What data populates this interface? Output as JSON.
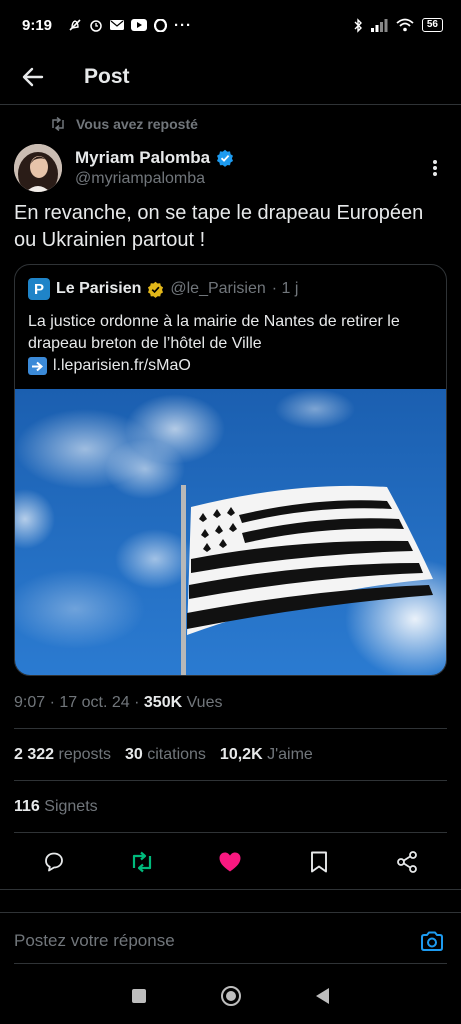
{
  "status_bar": {
    "time": "9:19",
    "battery": "56",
    "left_icons": [
      "do-not-disturb-icon",
      "alarm-icon",
      "mail-icon",
      "youtube-icon",
      "opera-icon",
      "more-icon"
    ],
    "right_icons": [
      "bluetooth-icon",
      "signal-icon",
      "wifi-icon",
      "battery-icon"
    ]
  },
  "header": {
    "title": "Post"
  },
  "repost": {
    "label": "Vous avez reposté"
  },
  "author": {
    "name": "Myriam Palomba",
    "handle": "@myriampalomba",
    "verified_color": "#1d9bf0"
  },
  "post": {
    "text": "En revanche, on se tape le drapeau Européen ou Ukrainien partout !"
  },
  "quote": {
    "logo_letter": "P",
    "name": "Le Parisien",
    "handle": "@le_Parisien",
    "time": "· 1 j",
    "text": "La justice ordonne à la mairie de Nantes de retirer le drapeau breton de l’hôtel de Ville",
    "link": "l.leparisien.fr/sMaO",
    "verified_color": "#e2b719"
  },
  "meta": {
    "time": "9:07",
    "date": "17 oct. 24",
    "views_count": "350K",
    "views_label": "Vues",
    "sep": "·"
  },
  "stats": {
    "reposts_count": "2 322",
    "reposts_label": "reposts",
    "quotes_count": "30",
    "quotes_label": "citations",
    "likes_count": "10,2K",
    "likes_label": "J'aime",
    "bookmarks_count": "116",
    "bookmarks_label": "Signets"
  },
  "actions": {
    "reply_icon": "reply-icon",
    "repost_icon": "repost-icon",
    "like_icon": "heart-icon",
    "bookmark_icon": "bookmark-icon",
    "share_icon": "share-icon",
    "repost_color": "#00ba7c",
    "like_color": "#f91880"
  },
  "reply": {
    "placeholder": "Postez votre réponse",
    "camera_color": "#1d9bf0"
  },
  "nav": {
    "icons": [
      "recents-icon",
      "home-icon",
      "back-icon"
    ]
  }
}
